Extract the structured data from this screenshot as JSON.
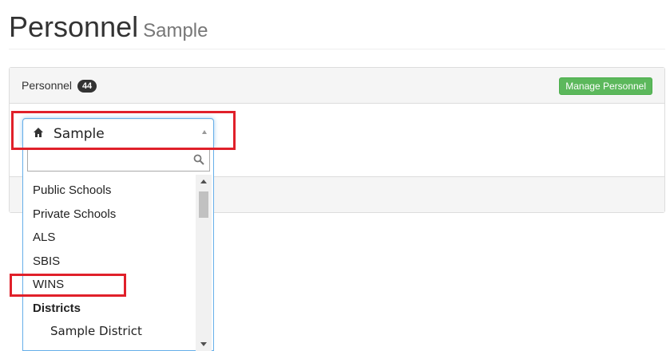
{
  "header": {
    "title": "Personnel",
    "subtitle": "Sample"
  },
  "panel": {
    "heading_label": "Personnel",
    "count_badge": "44",
    "manage_button_label": "Manage Personnel"
  },
  "org_select": {
    "selected_value": "Sample",
    "icon": "home-icon",
    "search_placeholder": "",
    "search_value": "",
    "options": [
      {
        "label": "Public Schools",
        "type": "option"
      },
      {
        "label": "Private Schools",
        "type": "option"
      },
      {
        "label": "ALS",
        "type": "option"
      },
      {
        "label": "SBIS",
        "type": "option"
      },
      {
        "label": "WINS",
        "type": "option",
        "highlighted": true
      },
      {
        "label": "Districts",
        "type": "group"
      },
      {
        "label": "Sample District",
        "type": "sub-option"
      }
    ]
  },
  "colors": {
    "success": "#5cb85c",
    "badge": "#333333",
    "highlight": "#e0202a",
    "focus": "#66afe9"
  }
}
